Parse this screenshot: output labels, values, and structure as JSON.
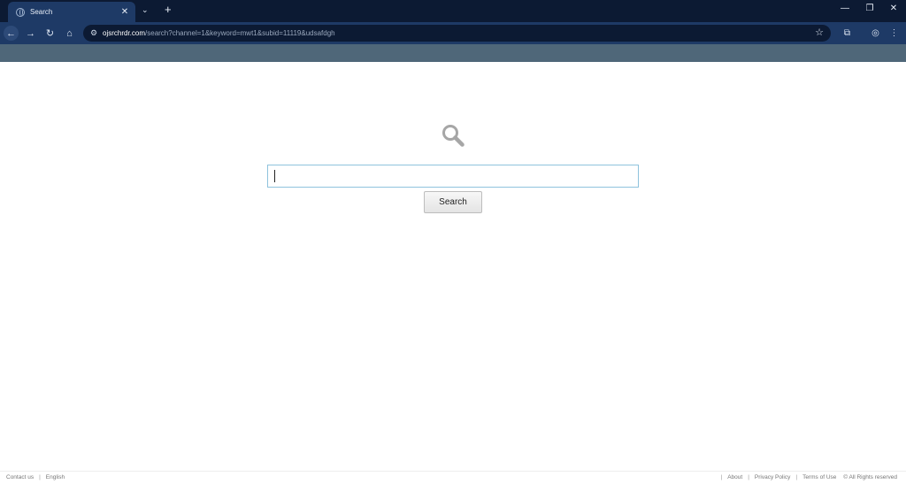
{
  "browser": {
    "tab": {
      "title": "Search"
    },
    "address_bar": {
      "host": "ojsrchrdr.com",
      "path": "/search?channel=1&keyword=mwt1&subid=11119&udsafdgh"
    }
  },
  "page": {
    "search_input": {
      "value": "",
      "placeholder": ""
    },
    "search_button_label": "Search"
  },
  "footer": {
    "left": {
      "contact": "Contact us",
      "language": "English"
    },
    "right": {
      "about": "About",
      "privacy": "Privacy Policy",
      "terms": "Terms of Use",
      "rights": "© All Rights reserved"
    }
  },
  "colors": {
    "tab_bar_bg": "#0c1a33",
    "toolbar_bg": "#1e3a66",
    "bookmark_strip_bg": "#4f6779",
    "input_border": "#8fc3dd"
  }
}
